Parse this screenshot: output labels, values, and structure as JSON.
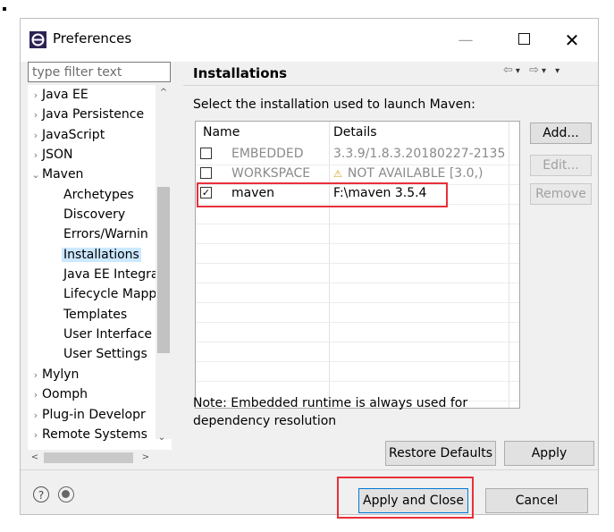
{
  "window": {
    "title": "Preferences",
    "minimize_glyph": "—",
    "close_glyph": "✕"
  },
  "filter": {
    "placeholder": "type filter text"
  },
  "tree": {
    "items": [
      {
        "label": "Java EE",
        "arrow": "›",
        "expanded": false
      },
      {
        "label": "Java Persistence",
        "arrow": "›",
        "expanded": false
      },
      {
        "label": "JavaScript",
        "arrow": "›",
        "expanded": false
      },
      {
        "label": "JSON",
        "arrow": "›",
        "expanded": false
      },
      {
        "label": "Maven",
        "arrow": "⌄",
        "expanded": true
      },
      {
        "label": "Archetypes",
        "child": true
      },
      {
        "label": "Discovery",
        "child": true
      },
      {
        "label": "Errors/Warnin",
        "child": true
      },
      {
        "label": "Installations",
        "child": true,
        "selected": true
      },
      {
        "label": "Java EE Integra",
        "child": true
      },
      {
        "label": "Lifecycle Mapp",
        "child": true
      },
      {
        "label": "Templates",
        "child": true
      },
      {
        "label": "User Interface",
        "child": true
      },
      {
        "label": "User Settings",
        "child": true
      },
      {
        "label": "Mylyn",
        "arrow": "›",
        "expanded": false
      },
      {
        "label": "Oomph",
        "arrow": "›",
        "expanded": false
      },
      {
        "label": "Plug-in Developr",
        "arrow": "›",
        "expanded": false
      },
      {
        "label": "Remote Systems",
        "arrow": "›",
        "expanded": false
      }
    ],
    "scroll_up_glyph": "^",
    "scroll_down_glyph": "⌄",
    "scroll_left_glyph": "<",
    "scroll_right_glyph": ">"
  },
  "page": {
    "title": "Installations",
    "description": "Select the installation used to launch Maven:",
    "nav_back_glyph": "⇦",
    "nav_forward_glyph": "⇨",
    "nav_drop_glyph": "▾"
  },
  "table": {
    "columns": [
      "Name",
      "Details"
    ],
    "rows": [
      {
        "name": "EMBEDDED",
        "details": "3.3.9/1.8.3.20180227-2135",
        "checked": false,
        "muted": true,
        "warning": false
      },
      {
        "name": "WORKSPACE",
        "details": "NOT AVAILABLE [3.0,)",
        "checked": false,
        "muted": true,
        "warning": true
      },
      {
        "name": "maven",
        "details": "F:\\maven 3.5.4",
        "checked": true,
        "muted": false,
        "warning": false
      }
    ],
    "warning_glyph": "⚠",
    "check_glyph": "✓"
  },
  "side_buttons": {
    "add": "Add...",
    "edit": "Edit...",
    "remove": "Remove"
  },
  "note": "Note: Embedded runtime is always used for dependency resolution",
  "buttons": {
    "restore_defaults": "Restore Defaults",
    "apply": "Apply",
    "apply_and_close": "Apply and Close",
    "cancel": "Cancel"
  },
  "footer": {
    "help_glyph": "?"
  },
  "colors": {
    "selection": "#cce8ff",
    "highlight_box": "#e8303a",
    "warning": "#d4a017"
  }
}
